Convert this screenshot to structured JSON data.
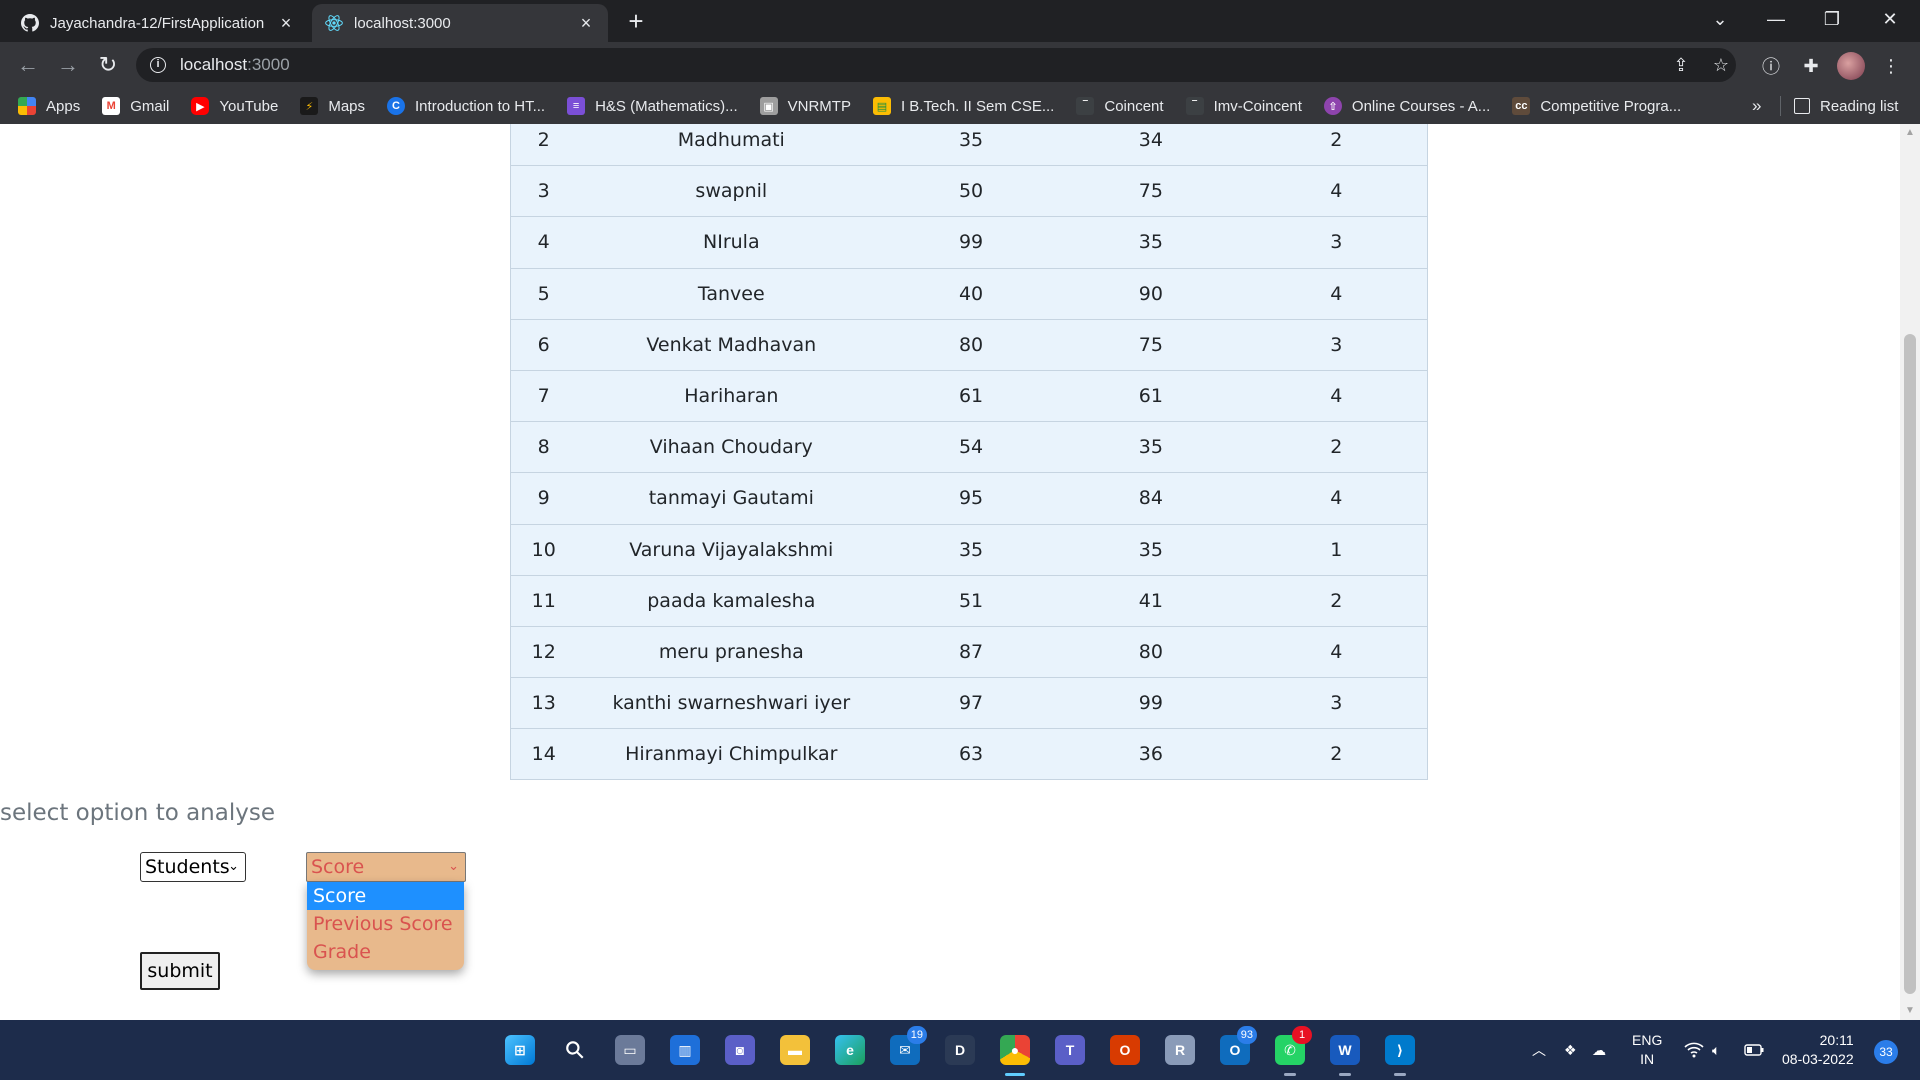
{
  "browser": {
    "tabs": [
      {
        "title": "Jayachandra-12/FirstApplication",
        "icon": "github-icon",
        "active": false
      },
      {
        "title": "localhost:3000",
        "icon": "react-icon",
        "active": true
      }
    ],
    "address": {
      "host": "localhost",
      "port": ":3000"
    },
    "bookmarks": [
      {
        "label": "Apps",
        "icon": "apps-grid-icon",
        "color": "#f4b400"
      },
      {
        "label": "Gmail",
        "icon": "gmail-icon",
        "color": "#ea4335"
      },
      {
        "label": "YouTube",
        "icon": "youtube-icon",
        "color": "#ff0000"
      },
      {
        "label": "Maps",
        "icon": "maps-icon",
        "color": "#1a1a1a"
      },
      {
        "label": "Introduction to HT...",
        "icon": "c-logo-icon",
        "color": "#1a73e8"
      },
      {
        "label": "H&S (Mathematics)...",
        "icon": "list-icon",
        "color": "#7b4fd6"
      },
      {
        "label": "VNRMTP",
        "icon": "page-icon",
        "color": "#9e9e9e"
      },
      {
        "label": "I B.Tech. II Sem CSE...",
        "icon": "classroom-icon",
        "color": "#fbbc04"
      },
      {
        "label": "Coincent",
        "icon": "coincent-icon",
        "color": "#3c4043"
      },
      {
        "label": "Imv-Coincent",
        "icon": "coincent-icon",
        "color": "#3c4043"
      },
      {
        "label": "Online Courses - A...",
        "icon": "courses-icon",
        "color": "#8e44ad"
      },
      {
        "label": "Competitive Progra...",
        "icon": "cc-icon",
        "color": "#5f4b3b"
      }
    ],
    "bookmarks_more": "»",
    "reading_list": "Reading list"
  },
  "table": {
    "rows": [
      [
        "2",
        "Madhumati",
        "35",
        "34",
        "2"
      ],
      [
        "3",
        "swapnil",
        "50",
        "75",
        "4"
      ],
      [
        "4",
        "NIrula",
        "99",
        "35",
        "3"
      ],
      [
        "5",
        "Tanvee",
        "40",
        "90",
        "4"
      ],
      [
        "6",
        "Venkat Madhavan",
        "80",
        "75",
        "3"
      ],
      [
        "7",
        "Hariharan",
        "61",
        "61",
        "4"
      ],
      [
        "8",
        "Vihaan Choudary",
        "54",
        "35",
        "2"
      ],
      [
        "9",
        "tanmayi Gautami",
        "95",
        "84",
        "4"
      ],
      [
        "10",
        "Varuna Vijayalakshmi",
        "35",
        "35",
        "1"
      ],
      [
        "11",
        "paada kamalesha",
        "51",
        "41",
        "2"
      ],
      [
        "12",
        "meru pranesha",
        "87",
        "80",
        "4"
      ],
      [
        "13",
        "kanthi swarneshwari iyer",
        "97",
        "99",
        "3"
      ],
      [
        "14",
        "Hiranmayi Chimpulkar",
        "63",
        "36",
        "2"
      ]
    ]
  },
  "analyse": {
    "heading": "select option to analyse",
    "entity_select": {
      "value": "Students"
    },
    "metric_select": {
      "value": "Score",
      "options": [
        "Score",
        "Previous Score",
        "Grade"
      ],
      "highlighted": "Score"
    },
    "submit_label": "submit"
  },
  "taskbar": {
    "apps": [
      {
        "name": "windows-start-icon",
        "badge": ""
      },
      {
        "name": "search-icon",
        "badge": ""
      },
      {
        "name": "task-view-icon",
        "badge": ""
      },
      {
        "name": "widgets-icon",
        "badge": ""
      },
      {
        "name": "chat-icon",
        "badge": ""
      },
      {
        "name": "file-explorer-icon",
        "badge": ""
      },
      {
        "name": "edge-icon",
        "badge": ""
      },
      {
        "name": "mail-icon",
        "badge": "19"
      },
      {
        "name": "dell-icon",
        "badge": ""
      },
      {
        "name": "chrome-icon",
        "badge": ""
      },
      {
        "name": "teams-icon",
        "badge": ""
      },
      {
        "name": "office-icon",
        "badge": ""
      },
      {
        "name": "r-icon",
        "badge": ""
      },
      {
        "name": "outlook-icon",
        "badge": "93"
      },
      {
        "name": "whatsapp-icon",
        "badge": "1"
      },
      {
        "name": "word-icon",
        "badge": ""
      },
      {
        "name": "vscode-icon",
        "badge": ""
      }
    ],
    "language": [
      "ENG",
      "IN"
    ],
    "time": "20:11",
    "date": "08-03-2022",
    "notifications": "33"
  }
}
